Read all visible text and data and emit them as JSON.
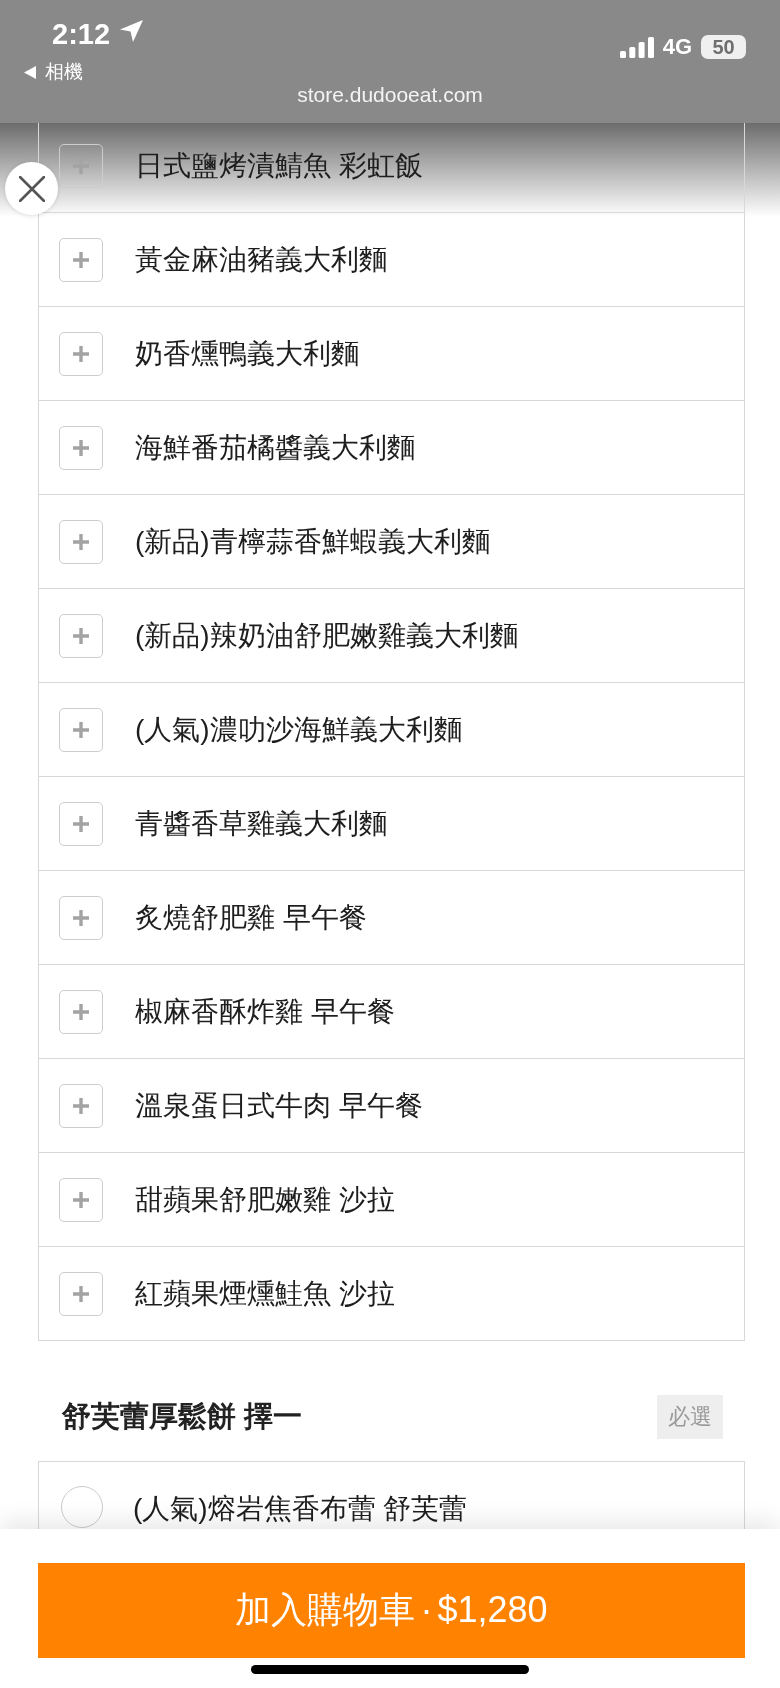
{
  "status_bar": {
    "time": "2:12",
    "back_label": "相機",
    "network": "4G",
    "battery": "50",
    "url": "store.dudooeat.com"
  },
  "sections": [
    {
      "kind": "multi",
      "items": [
        {
          "label": "日式鹽烤漬鯖魚 彩虹飯",
          "selected": false
        },
        {
          "label": "黃金麻油豬義大利麵",
          "selected": false
        },
        {
          "label": "奶香燻鴨義大利麵",
          "selected": false
        },
        {
          "label": "海鮮番茄橘醬義大利麵",
          "selected": false
        },
        {
          "label": "(新品)青檸蒜香鮮蝦義大利麵",
          "selected": false
        },
        {
          "label": "(新品)辣奶油舒肥嫩雞義大利麵",
          "selected": false
        },
        {
          "label": "(人氣)濃叻沙海鮮義大利麵",
          "selected": false
        },
        {
          "label": "青醬香草雞義大利麵",
          "selected": false
        },
        {
          "label": "炙燒舒肥雞 早午餐",
          "selected": false
        },
        {
          "label": "椒麻香酥炸雞 早午餐",
          "selected": false
        },
        {
          "label": "溫泉蛋日式牛肉 早午餐",
          "selected": false
        },
        {
          "label": "甜蘋果舒肥嫩雞 沙拉",
          "selected": false
        },
        {
          "label": "紅蘋果煙燻鮭魚 沙拉",
          "selected": false
        }
      ]
    },
    {
      "kind": "radio",
      "title": "舒芙蕾厚鬆餅 擇一",
      "badge": "必選",
      "items": [
        {
          "label": "(人氣)熔岩焦香布蕾 舒芙蕾",
          "selected": false
        }
      ]
    }
  ],
  "add_to_cart_button": {
    "label": "加入購物車 · $1,280"
  }
}
